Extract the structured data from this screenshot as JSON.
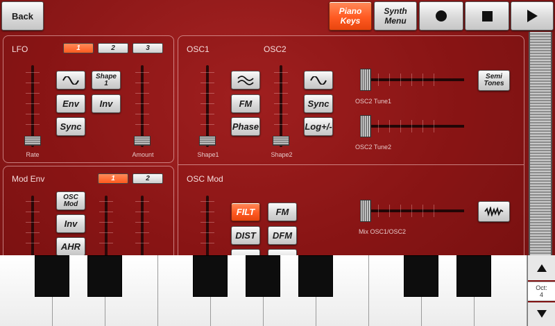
{
  "topbar": {
    "back_label": "Back",
    "piano_keys_label": "Piano\nKeys",
    "synth_menu_label": "Synth\nMenu",
    "record_icon": "record-icon",
    "stop_icon": "stop-icon",
    "play_icon": "play-icon"
  },
  "lfo": {
    "title": "LFO",
    "tabs": [
      "1",
      "2",
      "3"
    ],
    "active_tab": "1",
    "buttons": {
      "shape": "Shape\n1",
      "env": "Env",
      "inv": "Inv",
      "sync": "Sync"
    },
    "rate_label": "Rate",
    "amount_label": "Amount"
  },
  "osc": {
    "osc1_title": "OSC1",
    "osc2_title": "OSC2",
    "buttons": {
      "fm": "FM",
      "phase": "Phase",
      "sync": "Sync",
      "log": "Log+/-"
    },
    "shape1_label": "Shape1",
    "shape2_label": "Shape2",
    "tune1_label": "OSC2 Tune1",
    "tune2_label": "OSC2 Tune2",
    "semitones_label": "Semi\nTones"
  },
  "modenv": {
    "title": "Mod Env",
    "tabs": [
      "1",
      "2"
    ],
    "active_tab": "1",
    "buttons": {
      "osc_mod": "OSC\nMod",
      "inv": "Inv",
      "ahr": "AHR"
    }
  },
  "oscmod": {
    "title": "OSC Mod",
    "buttons": {
      "filt": "FILT",
      "fm": "FM",
      "dist": "DIST",
      "dfm": "DFM"
    },
    "mix_label": "Mix OSC1/OSC2"
  },
  "octave": {
    "up_icon": "arrow-up-icon",
    "down_icon": "arrow-down-icon",
    "label": "Oct:",
    "value": "4"
  },
  "colors": {
    "accent": "#ff5a22",
    "background": "#8e1818"
  }
}
